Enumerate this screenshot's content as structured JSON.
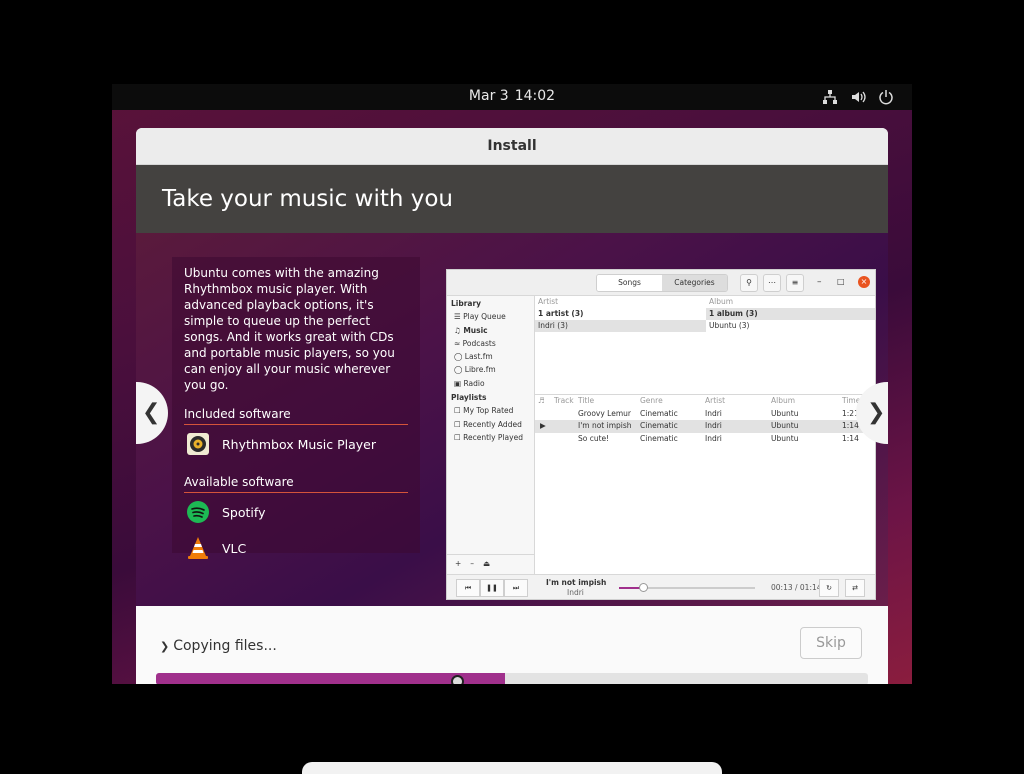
{
  "topbar": {
    "date": "Mar 3",
    "time": "14:02",
    "tray_icons": [
      "network-icon",
      "volume-icon",
      "power-icon"
    ]
  },
  "window": {
    "title": "Install"
  },
  "slide": {
    "heading": "Take your music with you",
    "description": "Ubuntu comes with the amazing Rhythmbox music player. With advanced playback options, it's simple to queue up the perfect songs. And it works great with CDs and portable music players, so you can enjoy all your music wherever you go.",
    "included_label": "Included software",
    "included": [
      {
        "name": "Rhythmbox Music Player",
        "icon": "rhythmbox-icon"
      }
    ],
    "available_label": "Available software",
    "available": [
      {
        "name": "Spotify",
        "icon": "spotify-icon"
      },
      {
        "name": "VLC",
        "icon": "vlc-icon"
      }
    ],
    "prev_icon": "chevron-left-icon",
    "next_icon": "chevron-right-icon"
  },
  "rhythmbox": {
    "tabs": [
      "Songs",
      "Categories"
    ],
    "sidebar": {
      "library_label": "Library",
      "library": [
        "Play Queue",
        "Music",
        "Podcasts",
        "Last.fm",
        "Libre.fm",
        "Radio"
      ],
      "playlists_label": "Playlists",
      "playlists": [
        "My Top Rated",
        "Recently Added",
        "Recently Played"
      ]
    },
    "browser": {
      "artist_header": "Artist",
      "artists": [
        "1 artist (3)",
        "Indri (3)"
      ],
      "album_header": "Album",
      "albums": [
        "1 album (3)",
        "Ubuntu (3)"
      ]
    },
    "track_headers": [
      "Track",
      "Title",
      "Genre",
      "Artist",
      "Album",
      "Time"
    ],
    "tracks": [
      {
        "title": "Groovy Lemur",
        "genre": "Cinematic",
        "artist": "Indri",
        "album": "Ubuntu",
        "time": "1:21"
      },
      {
        "title": "I'm not impish",
        "genre": "Cinematic",
        "artist": "Indri",
        "album": "Ubuntu",
        "time": "1:14"
      },
      {
        "title": "So cute!",
        "genre": "Cinematic",
        "artist": "Indri",
        "album": "Ubuntu",
        "time": "1:14"
      }
    ],
    "now_playing": {
      "title": "I'm not impish",
      "artist": "Indri",
      "position": "00:13 / 01:14",
      "progress": 0.18
    }
  },
  "install": {
    "status": "Copying files...",
    "skip_label": "Skip",
    "progress": 0.49
  }
}
